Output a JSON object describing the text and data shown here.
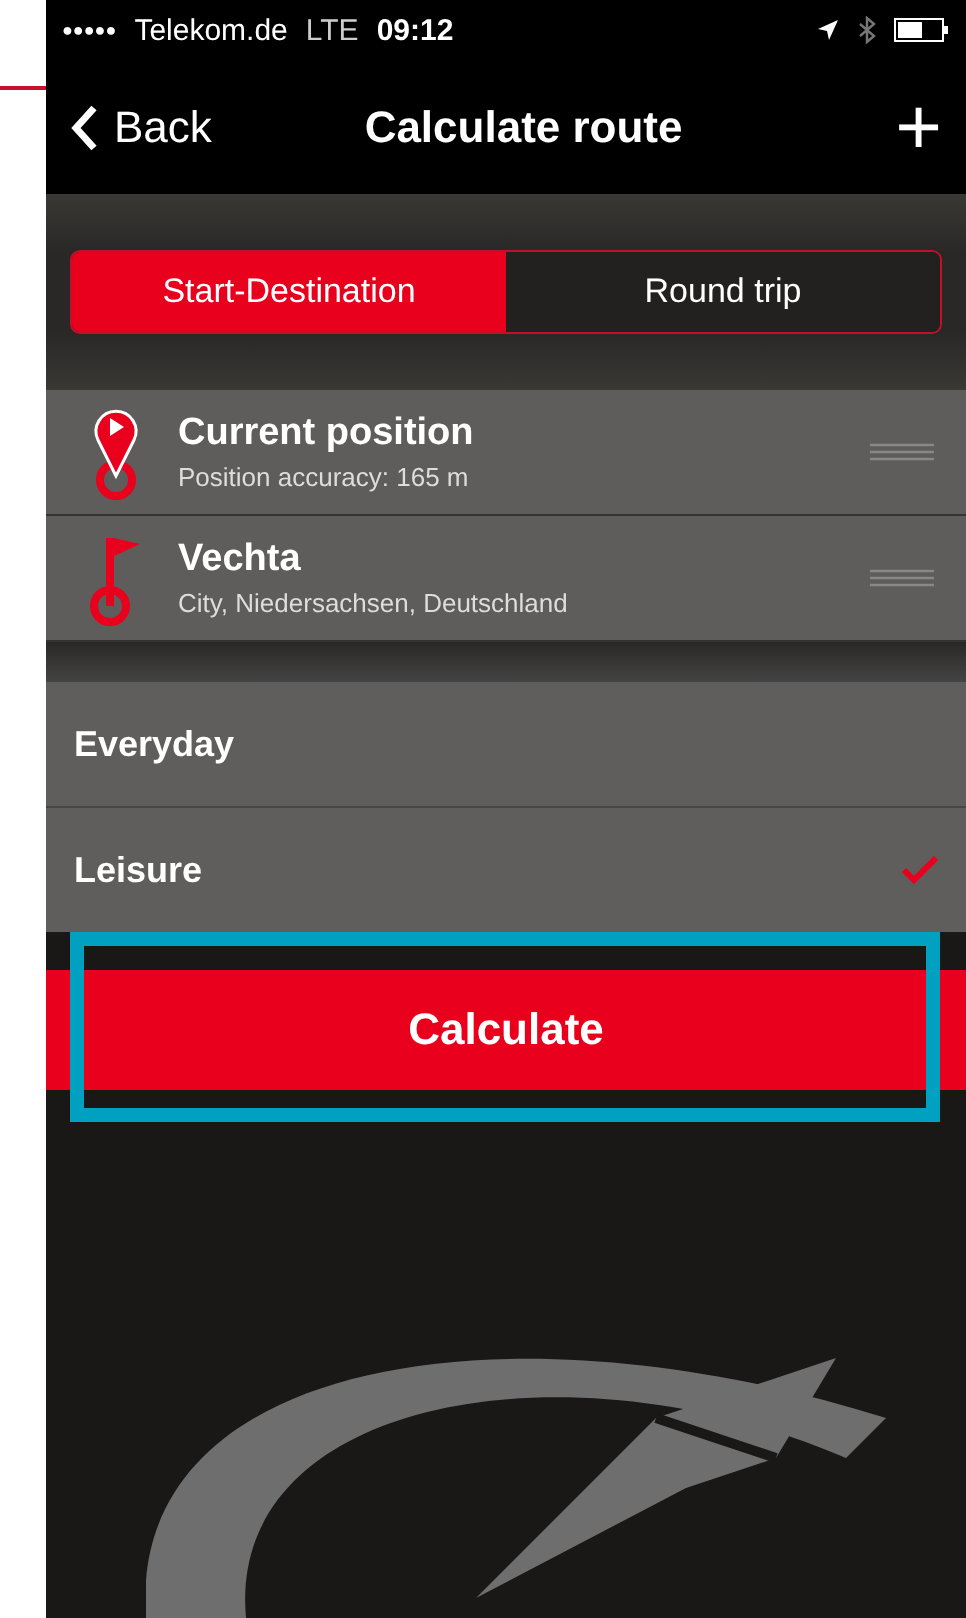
{
  "status_bar": {
    "signal_dots": "●●●●●",
    "carrier": "Telekom.de",
    "network": "LTE",
    "time": "09:12"
  },
  "nav_bar": {
    "back": "Back",
    "title": "Calculate route",
    "add": "+"
  },
  "tabs": [
    {
      "label": "Start-Destination",
      "selected": true
    },
    {
      "label": "Round trip",
      "selected": false
    }
  ],
  "waypoints": [
    {
      "kind": "start",
      "name": "Current position",
      "detail": "Position accuracy: 165 m"
    },
    {
      "kind": "destination",
      "name": "Vechta",
      "detail": "City, Niedersachsen, Deutschland"
    }
  ],
  "profiles": [
    {
      "label": "Everyday",
      "selected": false
    },
    {
      "label": "Leisure",
      "selected": true
    }
  ],
  "calculate_button": {
    "label": "Calculate",
    "highlighted": true
  }
}
